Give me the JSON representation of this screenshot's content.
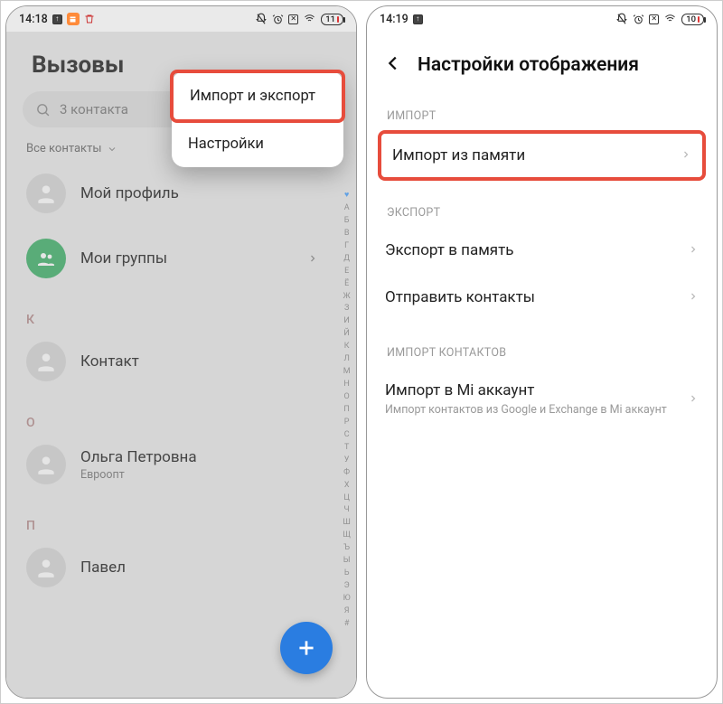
{
  "left": {
    "status": {
      "time": "14:18",
      "battery": "11"
    },
    "title": "Вызовы",
    "search_placeholder": "3 контакта",
    "filter_label": "Все контакты",
    "my_profile": "Мой профиль",
    "my_groups": "Мои группы",
    "sections": {
      "k": "К",
      "k_item": "Контакт",
      "o": "О",
      "o_item": "Ольга Петровна",
      "o_sub": "Евроопт",
      "p": "П",
      "p_item": "Павел"
    },
    "dropdown": {
      "import_export": "Импорт и экспорт",
      "settings": "Настройки"
    },
    "alpha_index": [
      "А",
      "Б",
      "В",
      "Г",
      "Д",
      "Е",
      "Ё",
      "Ж",
      "З",
      "И",
      "Й",
      "К",
      "Л",
      "М",
      "Н",
      "О",
      "П",
      "Р",
      "С",
      "Т",
      "У",
      "Ф",
      "Х",
      "Ц",
      "Ч",
      "Ш",
      "Щ",
      "Ъ",
      "Ы",
      "Ь",
      "Э",
      "Ю",
      "Я",
      "#"
    ]
  },
  "right": {
    "status": {
      "time": "14:19",
      "battery": "10"
    },
    "title": "Настройки отображения",
    "section_import": "ИМПОРТ",
    "import_from_memory": "Импорт из памяти",
    "section_export": "ЭКСПОРТ",
    "export_to_memory": "Экспорт в память",
    "send_contacts": "Отправить контакты",
    "section_import_contacts": "ИМПОРТ КОНТАКТОВ",
    "import_mi": "Импорт в Mi аккаунт",
    "import_mi_sub": "Импорт контактов из Google и Exchange в Mi аккаунт"
  }
}
